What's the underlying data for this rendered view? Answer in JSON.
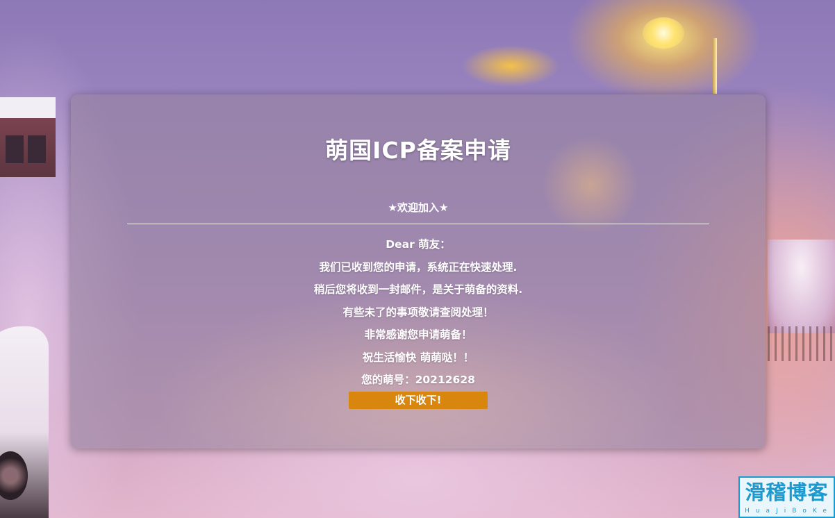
{
  "page": {
    "title": "萌国ICP备案申请",
    "welcome": "★欢迎加入★",
    "greeting": "Dear 萌友：",
    "lines": [
      "我们已收到您的申请，系统正在快速处理.",
      "稍后您将收到一封邮件，是关于萌备的资料.",
      "有些未了的事项敬请查阅处理！",
      "非常感谢您申请萌备！",
      "祝生活愉快 萌萌哒！！"
    ],
    "number_label": "您的萌号：",
    "number_value": "20212628",
    "button_label": "收下收下!"
  },
  "watermark": {
    "chinese": "滑稽博客",
    "pinyin": "HuaJiBoKe"
  },
  "colors": {
    "button": "#d9860f",
    "card_bg": "rgba(150,130,160,0.62)",
    "watermark": "#1c9ad0"
  }
}
